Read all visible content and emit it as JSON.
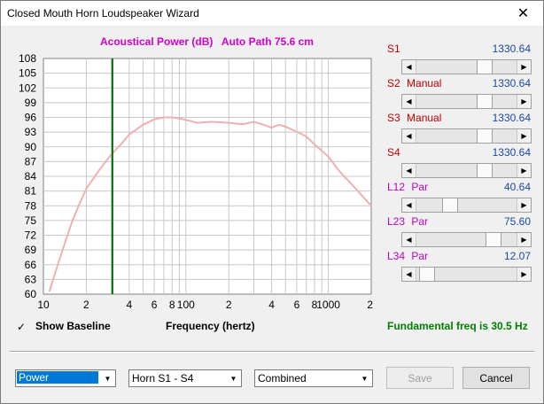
{
  "window": {
    "title": "Closed Mouth Horn Loudspeaker Wizard",
    "close_glyph": "✕"
  },
  "chart_title": "Acoustical Power (dB)   Auto Path 75.6 cm",
  "chart_data": {
    "type": "line",
    "title": "Acoustical Power (dB)   Auto Path 75.6 cm",
    "xlabel": "Frequency (hertz)",
    "ylabel": "",
    "x_scale": "log",
    "xlim": [
      10,
      2000
    ],
    "ylim": [
      60,
      108
    ],
    "y_ticks": [
      "108",
      "105",
      "102",
      "99",
      "96",
      "93",
      "90",
      "87",
      "84",
      "81",
      "78",
      "75",
      "72",
      "69",
      "66",
      "63",
      "60"
    ],
    "x_tick_labels": [
      {
        "value": 10,
        "label": "10"
      },
      {
        "value": 20,
        "label": "2"
      },
      {
        "value": 40,
        "label": "4"
      },
      {
        "value": 60,
        "label": "6"
      },
      {
        "value": 80,
        "label": "8"
      },
      {
        "value": 100,
        "label": "100"
      },
      {
        "value": 200,
        "label": "2"
      },
      {
        "value": 400,
        "label": "4"
      },
      {
        "value": 600,
        "label": "6"
      },
      {
        "value": 800,
        "label": "8"
      },
      {
        "value": 1000,
        "label": "1000"
      },
      {
        "value": 2000,
        "label": "2"
      }
    ],
    "marker": {
      "x": 30.5,
      "color": "#007000"
    },
    "series": [
      {
        "color": "#f0b0b0",
        "x": [
          11,
          12,
          14,
          16,
          18,
          20,
          25,
          30,
          35,
          40,
          50,
          60,
          70,
          80,
          90,
          100,
          120,
          150,
          200,
          250,
          300,
          350,
          400,
          450,
          500,
          600,
          700,
          800,
          1000,
          1200,
          1500,
          2000
        ],
        "y": [
          60.5,
          64,
          70,
          75,
          78.5,
          81.5,
          85.5,
          88.5,
          90.5,
          92.5,
          94.5,
          95.6,
          96.0,
          96.0,
          95.8,
          95.5,
          94.9,
          95.1,
          94.9,
          94.6,
          95.1,
          94.5,
          93.9,
          94.5,
          94.1,
          93.1,
          92.1,
          90.5,
          88.0,
          85.0,
          82.0,
          78.0
        ]
      }
    ]
  },
  "sliders": [
    {
      "name": "S1",
      "mode": "",
      "value": "1330.64",
      "level": 0.7,
      "label_color": "#c00000",
      "mode_color": "#c00000"
    },
    {
      "name": "S2",
      "mode": "Manual",
      "value": "1330.64",
      "level": 0.7,
      "label_color": "#c00000",
      "mode_color": "#c00000"
    },
    {
      "name": "S3",
      "mode": "Manual",
      "value": "1330.64",
      "level": 0.7,
      "label_color": "#c00000",
      "mode_color": "#c00000"
    },
    {
      "name": "S4",
      "mode": "",
      "value": "1330.64",
      "level": 0.7,
      "label_color": "#c00000",
      "mode_color": "#c00000"
    },
    {
      "name": "L12",
      "mode": "Par",
      "value": "40.64",
      "level": 0.3,
      "label_color": "#c000c0",
      "mode_color": "#c000c0"
    },
    {
      "name": "L23",
      "mode": "Par",
      "value": "75.60",
      "level": 0.8,
      "label_color": "#c000c0",
      "mode_color": "#c000c0"
    },
    {
      "name": "L34",
      "mode": "Par",
      "value": "12.07",
      "level": 0.04,
      "label_color": "#c000c0",
      "mode_color": "#c000c0"
    }
  ],
  "show_baseline": {
    "label": "Show Baseline",
    "checked": "✓"
  },
  "x_axis_label": "Frequency (hertz)",
  "fundamental": "Fundamental freq is 30.5 Hz",
  "selects": [
    {
      "value": "Power"
    },
    {
      "value": "Horn S1 - S4"
    },
    {
      "value": "Combined"
    }
  ],
  "buttons": {
    "save": "Save",
    "cancel": "Cancel"
  },
  "colors": {
    "grid": "#c8c8c8",
    "plot_bg": "#ffffff",
    "accent": "#0078d7"
  }
}
